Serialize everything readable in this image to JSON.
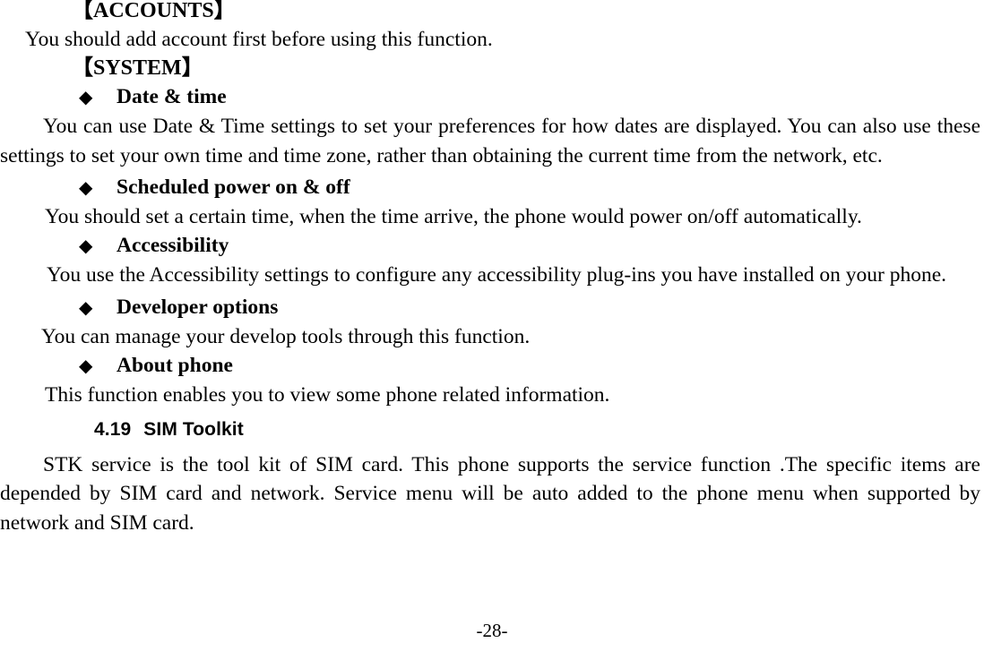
{
  "document": {
    "page_number_label": "-28-",
    "blocks": [
      {
        "kind": "bracket-head",
        "text": "【ACCOUNTS】"
      },
      {
        "kind": "para-short",
        "text": "You should add account first before using this function."
      },
      {
        "kind": "bracket-head",
        "text": "【SYSTEM】"
      },
      {
        "kind": "bullet",
        "bullet_glyph": "◆",
        "text": "Date & time"
      },
      {
        "kind": "para-just",
        "text": "You can use Date & Time settings to set your preferences for how dates are displayed. You can also use these settings to set your own time and time zone, rather than obtaining the current time from the network, etc."
      },
      {
        "kind": "bullet",
        "bullet_glyph": "◆",
        "text": "Scheduled power on & off"
      },
      {
        "kind": "para-short",
        "text": "You should set a certain time, when the time arrive, the phone would power on/off automatically."
      },
      {
        "kind": "bullet",
        "bullet_glyph": "◆",
        "text": "Accessibility"
      },
      {
        "kind": "para-just",
        "text": "You use the Accessibility settings to configure any accessibility plug-ins you have installed on your phone."
      },
      {
        "kind": "bullet",
        "bullet_glyph": "◆",
        "text": "Developer options"
      },
      {
        "kind": "para-short",
        "text": "You can manage your develop tools through this function."
      },
      {
        "kind": "bullet",
        "bullet_glyph": "◆",
        "text": "About phone"
      },
      {
        "kind": "para-short",
        "text": "This function enables you to view some phone related information."
      },
      {
        "kind": "section-head",
        "number": "4.19",
        "text": "SIM Toolkit"
      },
      {
        "kind": "para-just",
        "text": "STK service is the tool kit of SIM card. This phone supports the service function .The specific items are depended by SIM card and network. Service menu will be auto added to the phone menu when supported by network and SIM card."
      }
    ]
  },
  "headings": {
    "accounts": "【ACCOUNTS】",
    "system": "【SYSTEM】",
    "sim_toolkit_number": "4.19",
    "sim_toolkit_title": "SIM Toolkit"
  },
  "bullets": {
    "glyph": "◆",
    "date_time": "Date & time",
    "scheduled_power": "Scheduled power on & off",
    "accessibility": "Accessibility",
    "developer_options": "Developer options",
    "about_phone": "About phone"
  },
  "paragraphs": {
    "accounts_body": "You should add account first before using this function.",
    "date_time_body": "You can use Date & Time settings to set your preferences for how dates are displayed. You can also use these settings to set your own time and time zone, rather than obtaining the current time from the network, etc.",
    "scheduled_power_body": "You should set a certain time, when the time arrive, the phone would power on/off automatically.",
    "accessibility_body": "You use the Accessibility settings to configure any accessibility plug-ins you have installed on your phone.",
    "developer_options_body": "You can manage your develop tools through this function.",
    "about_phone_body": "This function enables you to view some phone related information.",
    "sim_toolkit_body": "STK service is the tool kit of SIM card. This phone supports the service function .The specific items are depended by SIM card and network. Service menu will be auto added to the phone menu when supported by network and SIM card."
  },
  "footer": {
    "page_label": "-28-"
  }
}
